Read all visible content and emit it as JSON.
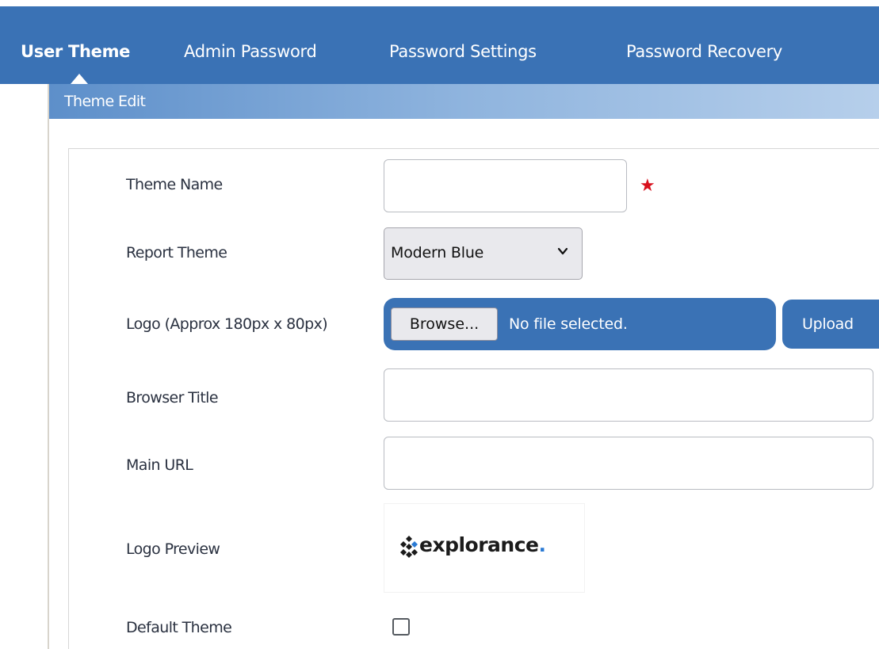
{
  "tabs": [
    {
      "label": "User Theme",
      "active": true
    },
    {
      "label": "Admin Password",
      "active": false
    },
    {
      "label": "Password Settings",
      "active": false
    },
    {
      "label": "Password Recovery",
      "active": false
    }
  ],
  "panel": {
    "title": "Theme Edit"
  },
  "form": {
    "theme_name": {
      "label": "Theme Name",
      "value": "",
      "required_mark": "★"
    },
    "report_theme": {
      "label": "Report Theme",
      "selected": "Modern Blue"
    },
    "logo": {
      "label": "Logo (Approx 180px x 80px)",
      "browse_label": "Browse...",
      "file_status": "No file selected.",
      "upload_label": "Upload"
    },
    "browser_title": {
      "label": "Browser Title",
      "value": ""
    },
    "main_url": {
      "label": "Main URL",
      "value": ""
    },
    "logo_preview": {
      "label": "Logo Preview",
      "logo_text": "explorance",
      "logo_dot": "."
    },
    "default_theme": {
      "label": "Default Theme",
      "checked": false
    }
  },
  "colors": {
    "brand": "#3a72b5",
    "required": "#d8101c",
    "logo_accent": "#2a7ad4"
  }
}
